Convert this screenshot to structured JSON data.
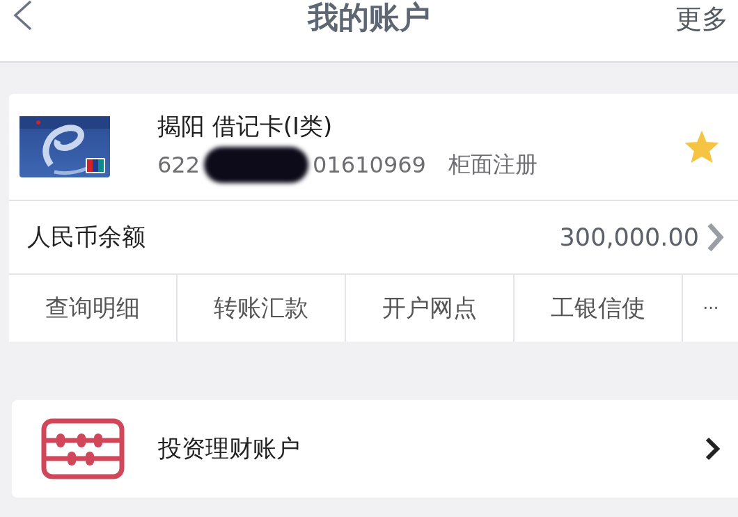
{
  "header": {
    "title": "我的账户",
    "more": "更多"
  },
  "account": {
    "name": "揭阳 借记卡(I类)",
    "number_start": "622",
    "number_end": "01610969",
    "registration": "柜面注册",
    "favorite": true,
    "balance_label": "人民币余额",
    "balance": "300,000.00",
    "actions": [
      "查询明细",
      "转账汇款",
      "开户网点",
      "工银信使",
      "···"
    ]
  },
  "investment": {
    "label": "投资理财账户"
  }
}
